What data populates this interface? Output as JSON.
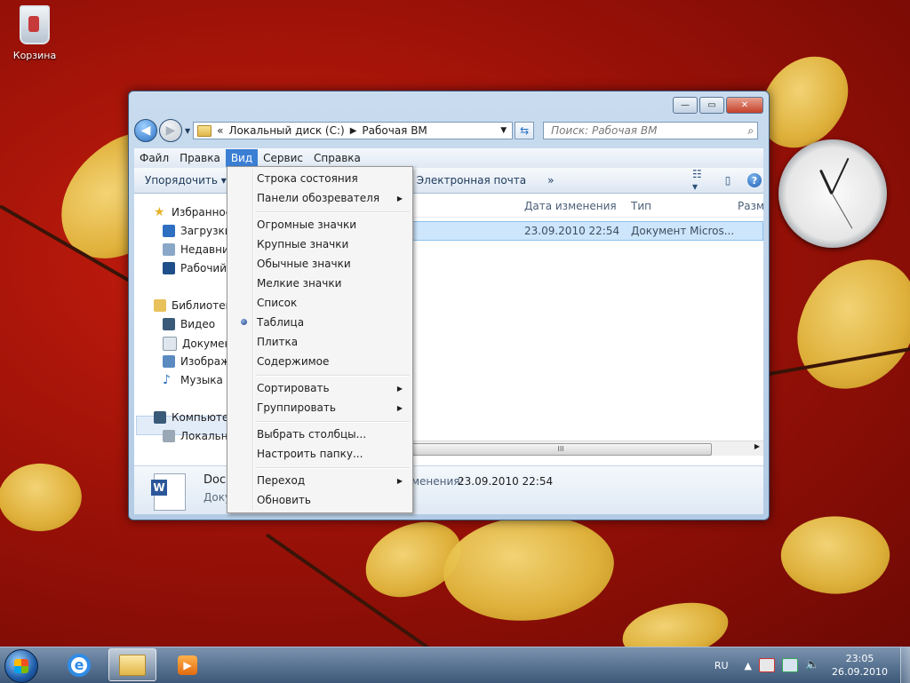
{
  "desktop": {
    "recycle_bin_label": "Корзина"
  },
  "window": {
    "controls": {
      "minimize": "—",
      "maximize": "▭",
      "close": "✕"
    },
    "address": {
      "prefix": "«",
      "crumbs": [
        "Локальный диск (C:)",
        "Рабочая ВМ"
      ]
    },
    "search_placeholder": "Поиск: Рабочая ВМ",
    "menubar": [
      "Файл",
      "Правка",
      "Вид",
      "Сервис",
      "Справка"
    ],
    "menubar_active": "Вид",
    "toolbar": {
      "organize": "Упорядочить",
      "email": "Электронная почта",
      "more": "»"
    },
    "nav": {
      "favorites": "Избранное",
      "downloads": "Загрузки",
      "recent": "Недавние",
      "desktop": "Рабочий",
      "libraries": "Библиотеки",
      "video": "Видео",
      "documents": "Документ",
      "images": "Изображ",
      "music": "Музыка",
      "computer": "Компьютер",
      "local": "Локальн"
    },
    "columns": {
      "date": "Дата изменения",
      "type": "Тип",
      "size": "Разм"
    },
    "file": {
      "date": "23.09.2010 22:54",
      "type": "Документ Micros..."
    },
    "scroll_grip": "III",
    "details": {
      "name": "Doc:",
      "sub": "Доку",
      "modified_label": "менения:",
      "modified": "23.09.2010 22:54"
    }
  },
  "view_menu": {
    "status_bar": "Строка состояния",
    "explorer_panes": "Панели обозревателя",
    "huge": "Огромные значки",
    "large": "Крупные значки",
    "normal": "Обычные значки",
    "small": "Мелкие значки",
    "list": "Список",
    "table": "Таблица",
    "tile": "Плитка",
    "content": "Содержимое",
    "sort": "Сортировать",
    "group": "Группировать",
    "choose_columns": "Выбрать столбцы...",
    "folder_options": "Настроить папку...",
    "go": "Переход",
    "refresh": "Обновить",
    "selected": "Таблица"
  },
  "taskbar": {
    "language": "RU",
    "time": "23:05",
    "date": "26.09.2010"
  }
}
